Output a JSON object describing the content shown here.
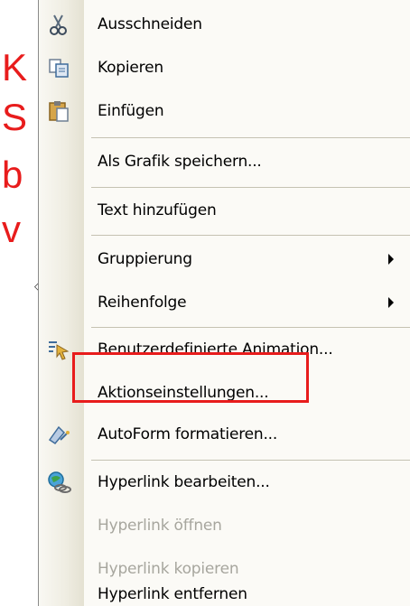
{
  "background": {
    "title_bar_color": "#e81c1c",
    "lines": [
      "K",
      "S",
      "b",
      "v"
    ]
  },
  "menu": {
    "items": [
      {
        "label": "Ausschneiden",
        "icon": "scissors-icon",
        "enabled": true
      },
      {
        "label": "Kopieren",
        "icon": "copy-icon",
        "enabled": true
      },
      {
        "label": "Einfügen",
        "icon": "paste-icon",
        "enabled": true
      },
      {
        "label": "Als Grafik speichern...",
        "icon": "",
        "enabled": true
      },
      {
        "label": "Text hinzufügen",
        "icon": "",
        "enabled": true
      },
      {
        "label": "Gruppierung",
        "icon": "",
        "enabled": true,
        "submenu": true
      },
      {
        "label": "Reihenfolge",
        "icon": "",
        "enabled": true,
        "submenu": true
      },
      {
        "label": "Benutzerdefinierte Animation...",
        "icon": "custom-animation-icon",
        "enabled": true
      },
      {
        "label": "Aktionseinstellungen...",
        "icon": "",
        "enabled": true,
        "highlighted": true
      },
      {
        "label": "AutoForm formatieren...",
        "icon": "format-autoshape-icon",
        "enabled": true
      },
      {
        "label": "Hyperlink bearbeiten...",
        "icon": "hyperlink-icon",
        "enabled": true
      },
      {
        "label": "Hyperlink öffnen",
        "icon": "",
        "enabled": false
      },
      {
        "label": "Hyperlink kopieren",
        "icon": "",
        "enabled": false
      },
      {
        "label": "Hyperlink entfernen",
        "icon": "",
        "enabled": true
      }
    ]
  },
  "colors": {
    "highlight_box": "#e81c1c",
    "disabled_text": "#a7a69e",
    "menu_background": "#fbfaf6"
  }
}
